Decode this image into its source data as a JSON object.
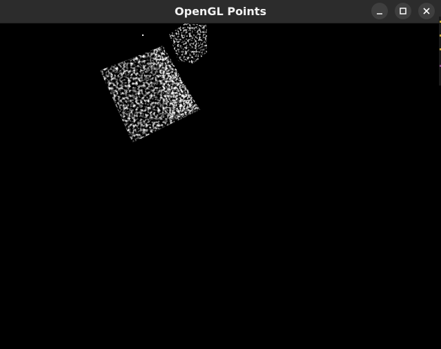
{
  "window": {
    "title": "OpenGL Points",
    "controls": [
      {
        "name": "minimize-button",
        "icon": "minimize-icon"
      },
      {
        "name": "maximize-button",
        "icon": "maximize-icon"
      },
      {
        "name": "close-button",
        "icon": "close-icon"
      }
    ]
  },
  "colors": {
    "titlebar": "#2c2c2c",
    "title_text": "#f2f2f2",
    "button_bg": "#3f3f3f",
    "button_glyph": "#ffffff",
    "canvas": "#000000",
    "points": "#ffffff"
  }
}
